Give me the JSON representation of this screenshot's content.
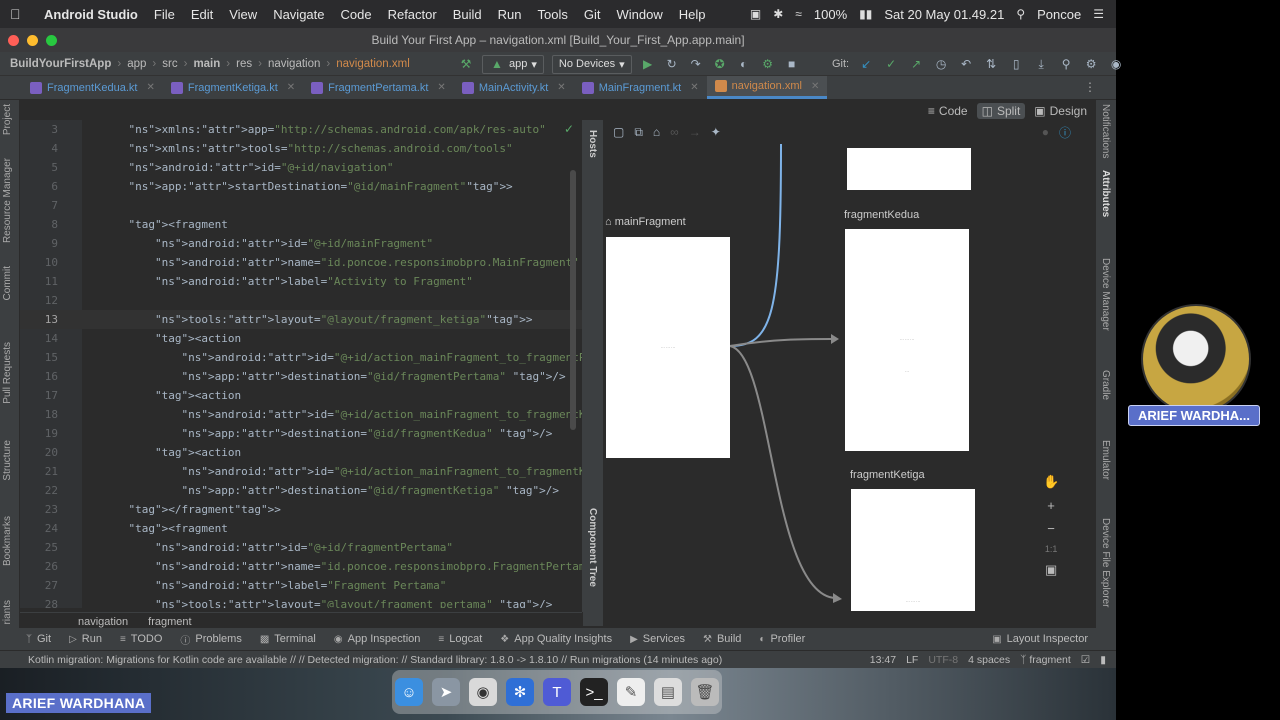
{
  "menubar": {
    "app": "Android Studio",
    "items": [
      "File",
      "Edit",
      "View",
      "Navigate",
      "Code",
      "Refactor",
      "Build",
      "Run",
      "Tools",
      "Git",
      "Window",
      "Help"
    ],
    "battery": "100%",
    "datetime": "Sat 20 May  01.49.21",
    "user": "Poncoe"
  },
  "window": {
    "title": "Build Your First App – navigation.xml [Build_Your_First_App.app.main]"
  },
  "navbar": {
    "crumbs": [
      "BuildYourFirstApp",
      "app",
      "src",
      "main",
      "res",
      "navigation",
      "navigation.xml"
    ],
    "run_config": "app",
    "device": "No Devices",
    "git_label": "Git:"
  },
  "tabs": [
    {
      "label": "FragmentKedua.kt"
    },
    {
      "label": "FragmentKetiga.kt"
    },
    {
      "label": "FragmentPertama.kt"
    },
    {
      "label": "MainActivity.kt"
    },
    {
      "label": "MainFragment.kt"
    },
    {
      "label": "navigation.xml"
    }
  ],
  "view_modes": {
    "code": "Code",
    "split": "Split",
    "design": "Design"
  },
  "left_stripe": [
    "Project",
    "Resource Manager",
    "Commit",
    "Pull Requests",
    "Structure",
    "Bookmarks",
    "riants"
  ],
  "right_stripe": [
    "Notifications",
    "Attributes",
    "Device Manager",
    "Gradle",
    "Emulator",
    "Device File Explorer"
  ],
  "editor": {
    "lines": [
      {
        "n": "3",
        "t": "    xmlns:app=\"http://schemas.android.com/apk/res-auto\""
      },
      {
        "n": "4",
        "t": "    xmlns:tools=\"http://schemas.android.com/tools\""
      },
      {
        "n": "5",
        "t": "    android:id=\"@+id/navigation\""
      },
      {
        "n": "6",
        "t": "    app:startDestination=\"@id/mainFragment\">"
      },
      {
        "n": "7",
        "t": ""
      },
      {
        "n": "8",
        "t": "    <fragment"
      },
      {
        "n": "9",
        "t": "        android:id=\"@+id/mainFragment\""
      },
      {
        "n": "10",
        "t": "        android:name=\"id.poncoe.responsimobpro.MainFragment\""
      },
      {
        "n": "11",
        "t": "        android:label=\"Activity to Fragment\""
      },
      {
        "n": "12",
        "t": ""
      },
      {
        "n": "13",
        "t": "        tools:layout=\"@layout/fragment_ketiga\">"
      },
      {
        "n": "14",
        "t": "        <action"
      },
      {
        "n": "15",
        "t": "            android:id=\"@+id/action_mainFragment_to_fragmentPertama\""
      },
      {
        "n": "16",
        "t": "            app:destination=\"@id/fragmentPertama\" />"
      },
      {
        "n": "17",
        "t": "        <action"
      },
      {
        "n": "18",
        "t": "            android:id=\"@+id/action_mainFragment_to_fragmentKedua\""
      },
      {
        "n": "19",
        "t": "            app:destination=\"@id/fragmentKedua\" />"
      },
      {
        "n": "20",
        "t": "        <action"
      },
      {
        "n": "21",
        "t": "            android:id=\"@+id/action_mainFragment_to_fragmentKetiga\""
      },
      {
        "n": "22",
        "t": "            app:destination=\"@id/fragmentKetiga\" />"
      },
      {
        "n": "23",
        "t": "    </fragment>"
      },
      {
        "n": "24",
        "t": "    <fragment"
      },
      {
        "n": "25",
        "t": "        android:id=\"@+id/fragmentPertama\""
      },
      {
        "n": "26",
        "t": "        android:name=\"id.poncoe.responsimobpro.FragmentPertama\""
      },
      {
        "n": "27",
        "t": "        android:label=\"Fragment Pertama\""
      },
      {
        "n": "28",
        "t": "        tools:layout=\"@layout/fragment_pertama\" />"
      }
    ],
    "breadcrumb": [
      "navigation",
      "fragment"
    ]
  },
  "design": {
    "hosts_label": "Hosts",
    "component_tree_label": "Component Tree",
    "fragments": {
      "main": "mainFragment",
      "kedua": "fragmentKedua",
      "ketiga": "fragmentKetiga"
    },
    "zoom_ratio": "1:1"
  },
  "bottom_tools": [
    "Git",
    "Run",
    "TODO",
    "Problems",
    "Terminal",
    "App Inspection",
    "Logcat",
    "App Quality Insights",
    "Services",
    "Build",
    "Profiler"
  ],
  "layout_inspector": "Layout Inspector",
  "status": {
    "message": "Kotlin migration: Migrations for Kotlin code are available // // Detected migration: //  Standard library: 1.8.0 -> 1.8.10 // Run migrations (14 minutes ago)",
    "position": "13:47",
    "line_sep": "LF",
    "encoding": "UTF-8",
    "indent": "4 spaces",
    "context": "fragment"
  },
  "presenter": {
    "badge_bottom": "ARIEF WARDHANA",
    "badge_cam": "ARIEF WARDHA..."
  }
}
